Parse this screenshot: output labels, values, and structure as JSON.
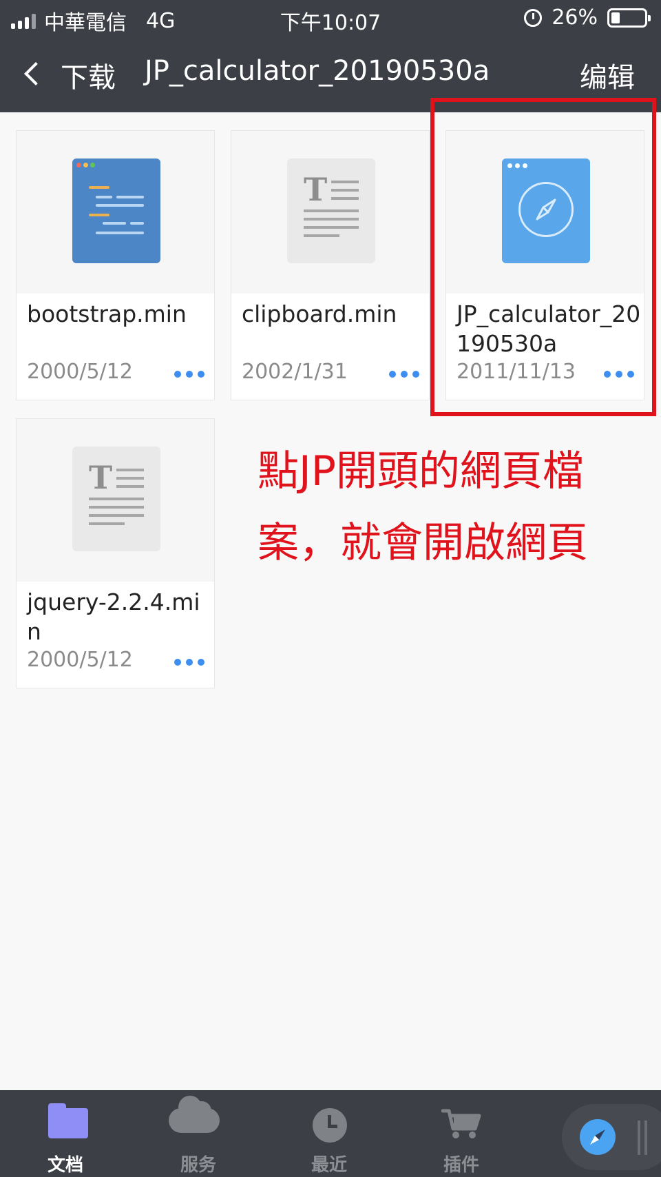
{
  "status_bar": {
    "carrier": "中華電信",
    "network": "4G",
    "time": "下午10:07",
    "battery": "26%",
    "battery_level": 0.26
  },
  "nav": {
    "back_label": "下载",
    "title": "JP_calculator_20190530a",
    "edit_label": "编辑"
  },
  "files": [
    {
      "name": "bootstrap.min",
      "date": "2000/5/12",
      "icon": "code-file-icon"
    },
    {
      "name": "clipboard.min",
      "date": "2002/1/31",
      "icon": "text-file-icon"
    },
    {
      "name": "JP_calculator_20190530a",
      "date": "2011/11/13",
      "icon": "web-file-icon"
    },
    {
      "name": "jquery-2.2.4.min",
      "date": "2000/5/12",
      "icon": "text-file-icon"
    }
  ],
  "annotation": {
    "line1": "點JP開頭的網頁檔",
    "line2": "案，就會開啟網頁",
    "color": "#e0131d"
  },
  "tabs": [
    {
      "label": "文档",
      "icon": "folder-icon",
      "active": true
    },
    {
      "label": "服务",
      "icon": "cloud-icon",
      "active": false
    },
    {
      "label": "最近",
      "icon": "clock-icon",
      "active": false
    },
    {
      "label": "插件",
      "icon": "cart-icon",
      "active": false
    }
  ],
  "colors": {
    "header_bg": "#3c4046",
    "accent_blue": "#3d8ef0",
    "highlight_red": "#e0131d"
  }
}
